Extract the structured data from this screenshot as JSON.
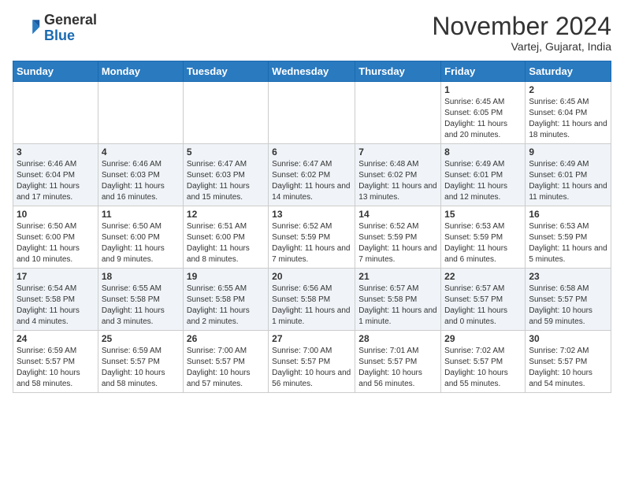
{
  "header": {
    "logo_line1": "General",
    "logo_line2": "Blue",
    "month_title": "November 2024",
    "location": "Vartej, Gujarat, India"
  },
  "weekdays": [
    "Sunday",
    "Monday",
    "Tuesday",
    "Wednesday",
    "Thursday",
    "Friday",
    "Saturday"
  ],
  "weeks": [
    [
      {
        "day": "",
        "info": ""
      },
      {
        "day": "",
        "info": ""
      },
      {
        "day": "",
        "info": ""
      },
      {
        "day": "",
        "info": ""
      },
      {
        "day": "",
        "info": ""
      },
      {
        "day": "1",
        "info": "Sunrise: 6:45 AM\nSunset: 6:05 PM\nDaylight: 11 hours and 20 minutes."
      },
      {
        "day": "2",
        "info": "Sunrise: 6:45 AM\nSunset: 6:04 PM\nDaylight: 11 hours and 18 minutes."
      }
    ],
    [
      {
        "day": "3",
        "info": "Sunrise: 6:46 AM\nSunset: 6:04 PM\nDaylight: 11 hours and 17 minutes."
      },
      {
        "day": "4",
        "info": "Sunrise: 6:46 AM\nSunset: 6:03 PM\nDaylight: 11 hours and 16 minutes."
      },
      {
        "day": "5",
        "info": "Sunrise: 6:47 AM\nSunset: 6:03 PM\nDaylight: 11 hours and 15 minutes."
      },
      {
        "day": "6",
        "info": "Sunrise: 6:47 AM\nSunset: 6:02 PM\nDaylight: 11 hours and 14 minutes."
      },
      {
        "day": "7",
        "info": "Sunrise: 6:48 AM\nSunset: 6:02 PM\nDaylight: 11 hours and 13 minutes."
      },
      {
        "day": "8",
        "info": "Sunrise: 6:49 AM\nSunset: 6:01 PM\nDaylight: 11 hours and 12 minutes."
      },
      {
        "day": "9",
        "info": "Sunrise: 6:49 AM\nSunset: 6:01 PM\nDaylight: 11 hours and 11 minutes."
      }
    ],
    [
      {
        "day": "10",
        "info": "Sunrise: 6:50 AM\nSunset: 6:00 PM\nDaylight: 11 hours and 10 minutes."
      },
      {
        "day": "11",
        "info": "Sunrise: 6:50 AM\nSunset: 6:00 PM\nDaylight: 11 hours and 9 minutes."
      },
      {
        "day": "12",
        "info": "Sunrise: 6:51 AM\nSunset: 6:00 PM\nDaylight: 11 hours and 8 minutes."
      },
      {
        "day": "13",
        "info": "Sunrise: 6:52 AM\nSunset: 5:59 PM\nDaylight: 11 hours and 7 minutes."
      },
      {
        "day": "14",
        "info": "Sunrise: 6:52 AM\nSunset: 5:59 PM\nDaylight: 11 hours and 7 minutes."
      },
      {
        "day": "15",
        "info": "Sunrise: 6:53 AM\nSunset: 5:59 PM\nDaylight: 11 hours and 6 minutes."
      },
      {
        "day": "16",
        "info": "Sunrise: 6:53 AM\nSunset: 5:59 PM\nDaylight: 11 hours and 5 minutes."
      }
    ],
    [
      {
        "day": "17",
        "info": "Sunrise: 6:54 AM\nSunset: 5:58 PM\nDaylight: 11 hours and 4 minutes."
      },
      {
        "day": "18",
        "info": "Sunrise: 6:55 AM\nSunset: 5:58 PM\nDaylight: 11 hours and 3 minutes."
      },
      {
        "day": "19",
        "info": "Sunrise: 6:55 AM\nSunset: 5:58 PM\nDaylight: 11 hours and 2 minutes."
      },
      {
        "day": "20",
        "info": "Sunrise: 6:56 AM\nSunset: 5:58 PM\nDaylight: 11 hours and 1 minute."
      },
      {
        "day": "21",
        "info": "Sunrise: 6:57 AM\nSunset: 5:58 PM\nDaylight: 11 hours and 1 minute."
      },
      {
        "day": "22",
        "info": "Sunrise: 6:57 AM\nSunset: 5:57 PM\nDaylight: 11 hours and 0 minutes."
      },
      {
        "day": "23",
        "info": "Sunrise: 6:58 AM\nSunset: 5:57 PM\nDaylight: 10 hours and 59 minutes."
      }
    ],
    [
      {
        "day": "24",
        "info": "Sunrise: 6:59 AM\nSunset: 5:57 PM\nDaylight: 10 hours and 58 minutes."
      },
      {
        "day": "25",
        "info": "Sunrise: 6:59 AM\nSunset: 5:57 PM\nDaylight: 10 hours and 58 minutes."
      },
      {
        "day": "26",
        "info": "Sunrise: 7:00 AM\nSunset: 5:57 PM\nDaylight: 10 hours and 57 minutes."
      },
      {
        "day": "27",
        "info": "Sunrise: 7:00 AM\nSunset: 5:57 PM\nDaylight: 10 hours and 56 minutes."
      },
      {
        "day": "28",
        "info": "Sunrise: 7:01 AM\nSunset: 5:57 PM\nDaylight: 10 hours and 56 minutes."
      },
      {
        "day": "29",
        "info": "Sunrise: 7:02 AM\nSunset: 5:57 PM\nDaylight: 10 hours and 55 minutes."
      },
      {
        "day": "30",
        "info": "Sunrise: 7:02 AM\nSunset: 5:57 PM\nDaylight: 10 hours and 54 minutes."
      }
    ]
  ]
}
